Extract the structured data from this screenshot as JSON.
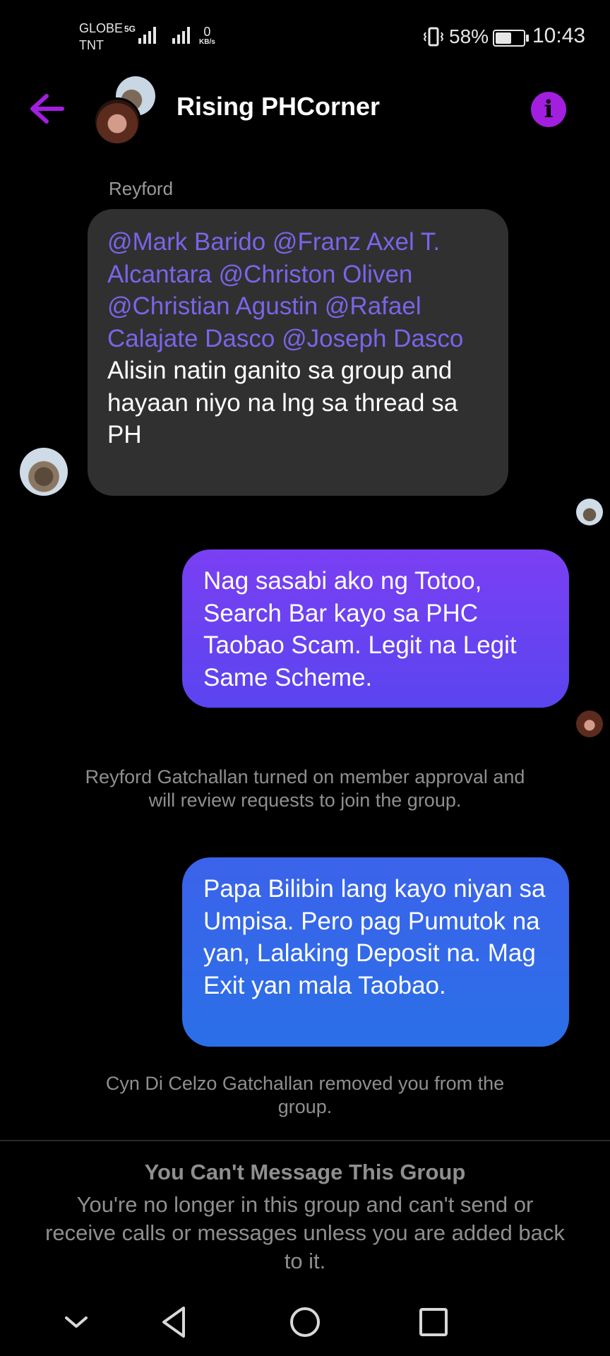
{
  "status_bar": {
    "carrier_1": "GLOBE",
    "carrier_2": "TNT",
    "network_type": "5G",
    "speed_value": "0",
    "speed_unit": "KB/s",
    "battery_percent": "58%",
    "battery_level": 0.58,
    "time": "10:43",
    "icons": [
      "signal-icon",
      "vibrate-icon",
      "battery-icon"
    ]
  },
  "header": {
    "title": "Rising PHCorner",
    "back_icon": "back-arrow-icon",
    "info_icon": "info-icon",
    "accent_color": "#a21fe0"
  },
  "messages": [
    {
      "type": "incoming",
      "sender": "Reyford",
      "mentions": "@Mark Barido @Franz Axel T. Alcantara @Christon Oliven @Christian Agustin @Rafael Calajate Dasco @Joseph Dasco",
      "text": "Alisin natin ganito sa group and hayaan niyo na lng sa thread sa PH"
    },
    {
      "type": "outgoing",
      "text": "Nag sasabi ako ng Totoo, Search Bar kayo sa PHC Taobao Scam. Legit na Legit Same Scheme."
    },
    {
      "type": "system",
      "text": "Reyford Gatchallan turned on member approval and will review requests to join the group."
    },
    {
      "type": "outgoing",
      "text": "Papa Bilibin lang kayo niyan sa Umpisa. Pero pag Pumutok na yan, Lalaking Deposit na. Mag Exit yan mala Taobao."
    },
    {
      "type": "system",
      "text": "Cyn Di Celzo Gatchallan removed you from the group."
    }
  ],
  "footer": {
    "title": "You Can't Message This Group",
    "body": "You're no longer in this group and can't send or receive calls or messages unless you are added back to it."
  },
  "nav_bar": {
    "icons": [
      "chevron-down-icon",
      "back-triangle-icon",
      "home-circle-icon",
      "recents-square-icon"
    ]
  },
  "colors": {
    "incoming_bubble": "#303030",
    "mention": "#7b64e8",
    "outgoing_purple": "#6a42f1",
    "outgoing_blue": "#3369e9",
    "system_text": "#8f8f8f"
  }
}
